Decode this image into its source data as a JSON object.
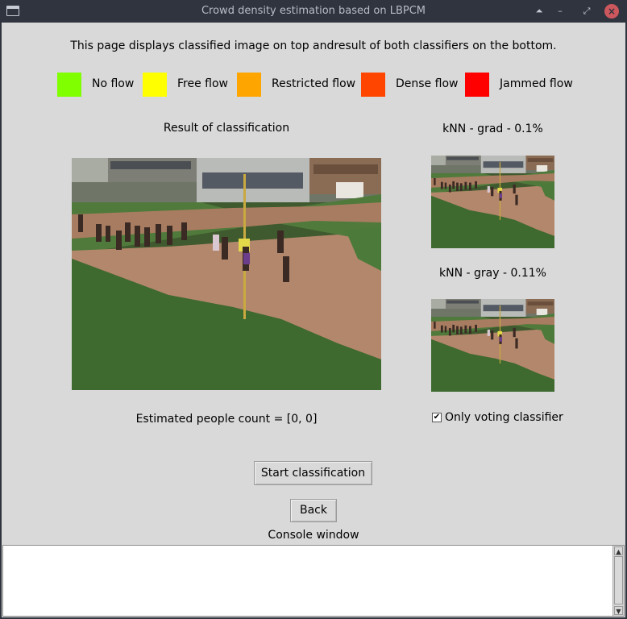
{
  "window": {
    "title": "Crowd density estimation based on LBPCM",
    "controls": {
      "shade": "⏶",
      "minimize": "–",
      "maximize": "⤢",
      "close": "×"
    }
  },
  "description": "This page displays classified image on top andresult of both classifiers on the bottom.",
  "legend": [
    {
      "label": "No flow",
      "color": "#7fff00"
    },
    {
      "label": "Free flow",
      "color": "#ffff00"
    },
    {
      "label": "Restricted flow",
      "color": "#ffa500"
    },
    {
      "label": "Dense flow",
      "color": "#ff4500"
    },
    {
      "label": "Jammed flow",
      "color": "#ff0000"
    }
  ],
  "result": {
    "title": "Result of classification",
    "people_count": "Estimated people count = [0, 0]"
  },
  "knn_grad": {
    "title": "kNN - grad - 0.1%"
  },
  "knn_gray": {
    "title": "kNN - gray - 0.11%"
  },
  "voting": {
    "label": "Only voting classifier",
    "checked": true,
    "check_glyph": "✔"
  },
  "buttons": {
    "start": "Start classification",
    "back": "Back"
  },
  "console": {
    "label": "Console window",
    "text": ""
  },
  "scrollbar": {
    "up_glyph": "▲",
    "down_glyph": "▼"
  }
}
